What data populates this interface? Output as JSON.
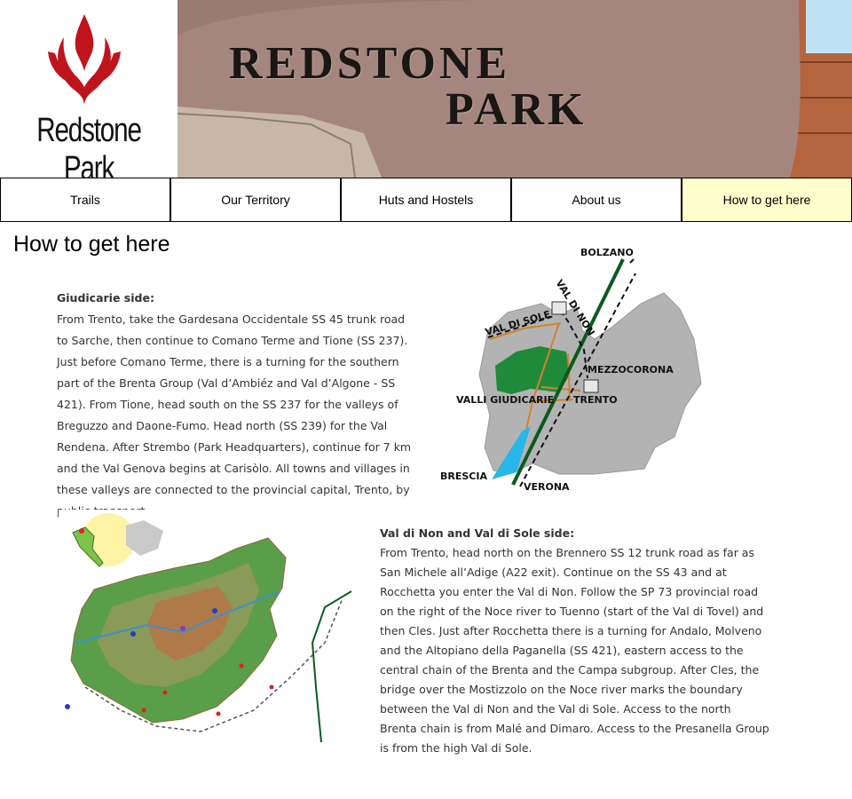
{
  "header": {
    "logo_text": "Redstone Park",
    "banner_line1": "REDSTONE",
    "banner_line2": "PARK",
    "logo_color": "#c0141c"
  },
  "nav": {
    "items": [
      {
        "label": "Trails"
      },
      {
        "label": "Our Territory"
      },
      {
        "label": "Huts and Hostels"
      },
      {
        "label": "About us"
      },
      {
        "label": "How to get here"
      }
    ],
    "active_index": 4,
    "active_color": "#ffffcc"
  },
  "page": {
    "title": "How to get here"
  },
  "sections": [
    {
      "heading": "Giudicarie side:",
      "body": "From Trento, take the Gardesana Occidentale SS 45 trunk road to Sarche, then continue to Comano Terme and Tione (SS 237). Just before Comano Terme, there is a turning for the southern part of the Brenta Group (Val d’Ambiéz and Val d’Algone - SS 421). From Tione, head south on the SS 237 for the valleys of Breguzzo and Daone-Fumo. Head north (SS 239) for the Val Rendena. After Strembo (Park Headquarters), continue for 7 km and the Val Genova begins at Carisòlo. All towns and villages in these valleys are connected to the provincial capital, Trento, by public transport."
    },
    {
      "heading": "Val di Non and Val di Sole side:",
      "body": "From Trento, head north on the Brennero SS 12 trunk road as far as San Michele all’Adige (A22 exit). Continue on the SS 43 and at Rocchetta you enter the Val di Non. Follow the SP 73 provincial road on the right of the Noce river to Tuenno (start of the Val di Tovel) and then Cles. Just after Rocchetta there is a turning for Andalo, Molveno and the Altopiano della Paganella (SS 421), eastern access to the central chain of the Brenta and the Campa subgroup. After Cles, the bridge over the Mostizzolo on the Noce river marks the boundary between the Val di Non and the Val di Sole. Access to the north Brenta chain is from Malé and Dimaro. Access to the Presanella Group is from the high Val di Sole."
    }
  ],
  "access_map": {
    "labels": {
      "bolzano": "BOLZANO",
      "val_di_non": "VAL DI NON",
      "val_di_sole": "VAL DI SOLE",
      "mezzocorona": "MEZZOCORONA",
      "valli_giudicarie": "VALLI GIUDICARIE",
      "trento": "TRENTO",
      "brescia": "BRESCIA",
      "verona": "VERONA"
    },
    "colors": {
      "region": "#b3b3b3",
      "park": "#1f8a3a",
      "road": "#d2822d",
      "highway": "#0b5a1f",
      "lake": "#29b6e8"
    }
  }
}
